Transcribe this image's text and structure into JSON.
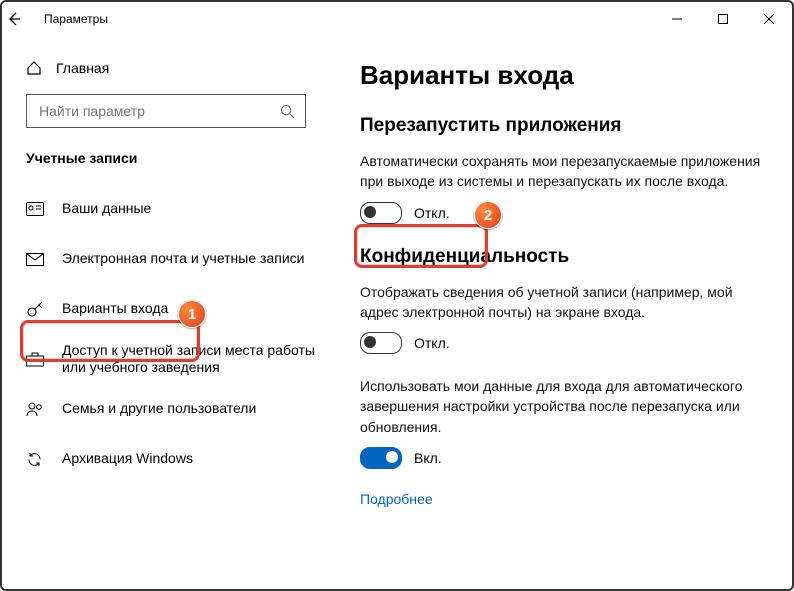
{
  "titlebar": {
    "back_aria": "Назад",
    "title": "Параметры"
  },
  "sidebar": {
    "home_label": "Главная",
    "search_placeholder": "Найти параметр",
    "section": "Учетные записи",
    "items": [
      {
        "label": "Ваши данные"
      },
      {
        "label": "Электронная почта и учетные записи"
      },
      {
        "label": "Варианты входа"
      },
      {
        "label": "Доступ к учетной записи места работы или учебного заведения"
      },
      {
        "label": "Семья и другие пользователи"
      },
      {
        "label": "Архивация Windows"
      }
    ]
  },
  "main": {
    "heading": "Варианты входа",
    "restart": {
      "title": "Перезапустить приложения",
      "desc": "Автоматически сохранять мои перезапускаемые приложения при выходе из системы и перезапускать их после входа.",
      "toggle_state": "Откл."
    },
    "privacy": {
      "title": "Конфиденциальность",
      "desc1": "Отображать сведения об учетной записи (например, мой адрес электронной почты) на экране входа.",
      "toggle1_state": "Откл.",
      "desc2": "Использовать мои данные для входа для автоматического завершения настройки устройства после перезапуска или обновления.",
      "toggle2_state": "Вкл.",
      "link": "Подробнее"
    }
  },
  "annotations": {
    "b1": "1",
    "b2": "2"
  }
}
